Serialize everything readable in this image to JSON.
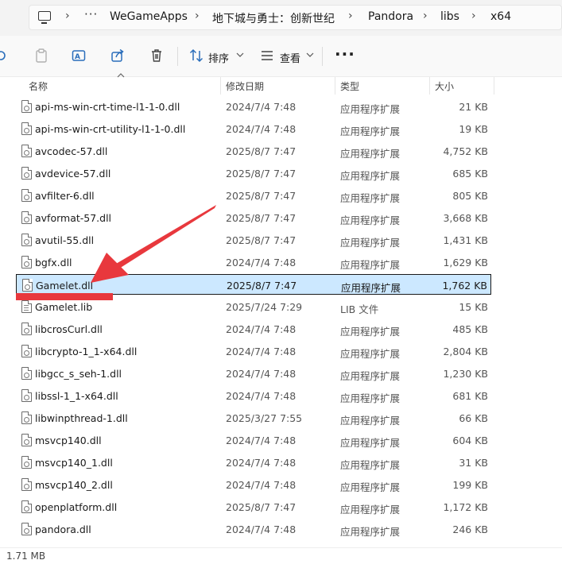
{
  "address_bar": {
    "overflow_label": "···",
    "crumbs": [
      "WeGameApps",
      "地下城与勇士：创新世纪",
      "Pandora",
      "libs",
      "x64"
    ]
  },
  "toolbar": {
    "sort_label": "排序",
    "view_label": "查看",
    "more_label": "···"
  },
  "columns": {
    "name": "名称",
    "date": "修改日期",
    "type": "类型",
    "size": "大小"
  },
  "files": [
    {
      "name": "api-ms-win-crt-time-l1-1-0.dll",
      "date": "2024/7/4 7:48",
      "type": "应用程序扩展",
      "size": "21 KB",
      "icon": "dll-file-icon"
    },
    {
      "name": "api-ms-win-crt-utility-l1-1-0.dll",
      "date": "2024/7/4 7:48",
      "type": "应用程序扩展",
      "size": "19 KB",
      "icon": "dll-file-icon"
    },
    {
      "name": "avcodec-57.dll",
      "date": "2025/8/7 7:47",
      "type": "应用程序扩展",
      "size": "4,752 KB",
      "icon": "dll-file-icon"
    },
    {
      "name": "avdevice-57.dll",
      "date": "2025/8/7 7:47",
      "type": "应用程序扩展",
      "size": "685 KB",
      "icon": "dll-file-icon"
    },
    {
      "name": "avfilter-6.dll",
      "date": "2025/8/7 7:47",
      "type": "应用程序扩展",
      "size": "805 KB",
      "icon": "dll-file-icon"
    },
    {
      "name": "avformat-57.dll",
      "date": "2025/8/7 7:47",
      "type": "应用程序扩展",
      "size": "3,668 KB",
      "icon": "dll-file-icon"
    },
    {
      "name": "avutil-55.dll",
      "date": "2025/8/7 7:47",
      "type": "应用程序扩展",
      "size": "1,431 KB",
      "icon": "dll-file-icon"
    },
    {
      "name": "bgfx.dll",
      "date": "2024/7/4 7:48",
      "type": "应用程序扩展",
      "size": "1,629 KB",
      "icon": "dll-file-icon"
    },
    {
      "name": "Gamelet.dll",
      "date": "2025/8/7 7:47",
      "type": "应用程序扩展",
      "size": "1,762 KB",
      "icon": "dll-file-icon",
      "selected": true
    },
    {
      "name": "Gamelet.lib",
      "date": "2025/7/24 7:29",
      "type": "LIB 文件",
      "size": "15 KB",
      "icon": "lib-file-icon"
    },
    {
      "name": "libcrosCurl.dll",
      "date": "2024/7/4 7:48",
      "type": "应用程序扩展",
      "size": "485 KB",
      "icon": "dll-file-icon"
    },
    {
      "name": "libcrypto-1_1-x64.dll",
      "date": "2024/7/4 7:48",
      "type": "应用程序扩展",
      "size": "2,804 KB",
      "icon": "dll-file-icon"
    },
    {
      "name": "libgcc_s_seh-1.dll",
      "date": "2024/7/4 7:48",
      "type": "应用程序扩展",
      "size": "1,230 KB",
      "icon": "dll-file-icon"
    },
    {
      "name": "libssl-1_1-x64.dll",
      "date": "2024/7/4 7:48",
      "type": "应用程序扩展",
      "size": "681 KB",
      "icon": "dll-file-icon"
    },
    {
      "name": "libwinpthread-1.dll",
      "date": "2025/3/27 7:55",
      "type": "应用程序扩展",
      "size": "66 KB",
      "icon": "dll-file-icon"
    },
    {
      "name": "msvcp140.dll",
      "date": "2024/7/4 7:48",
      "type": "应用程序扩展",
      "size": "604 KB",
      "icon": "dll-file-icon"
    },
    {
      "name": "msvcp140_1.dll",
      "date": "2024/7/4 7:48",
      "type": "应用程序扩展",
      "size": "31 KB",
      "icon": "dll-file-icon"
    },
    {
      "name": "msvcp140_2.dll",
      "date": "2024/7/4 7:48",
      "type": "应用程序扩展",
      "size": "199 KB",
      "icon": "dll-file-icon"
    },
    {
      "name": "openplatform.dll",
      "date": "2025/8/7 7:47",
      "type": "应用程序扩展",
      "size": "1,172 KB",
      "icon": "dll-file-icon"
    },
    {
      "name": "pandora.dll",
      "date": "2024/7/4 7:48",
      "type": "应用程序扩展",
      "size": "246 KB",
      "icon": "dll-file-icon"
    }
  ],
  "status_bar": {
    "selection_size": "1.71 MB"
  },
  "colors": {
    "selection_bg": "#cce8ff",
    "annotation_red": "#e8383d",
    "addressbar_bg": "#f3f3f3"
  }
}
